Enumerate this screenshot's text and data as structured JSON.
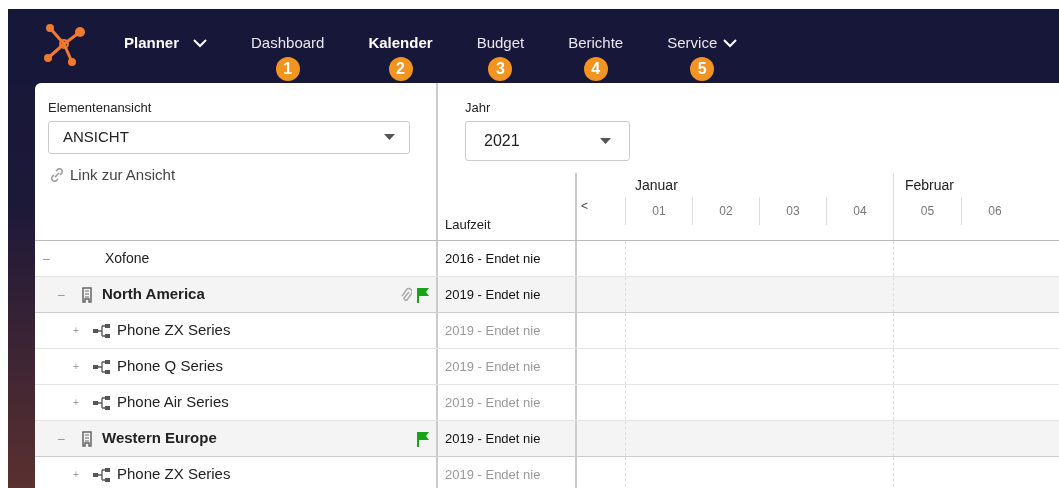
{
  "nav": {
    "app_menu": {
      "label": "Planner"
    },
    "items": [
      {
        "label": "Dashboard",
        "badge": "1",
        "selected": false,
        "has_menu": false
      },
      {
        "label": "Kalender",
        "badge": "2",
        "selected": true,
        "has_menu": false
      },
      {
        "label": "Budget",
        "badge": "3",
        "selected": false,
        "has_menu": false
      },
      {
        "label": "Berichte",
        "badge": "4",
        "selected": false,
        "has_menu": false
      },
      {
        "label": "Service",
        "badge": "5",
        "selected": false,
        "has_menu": true
      }
    ]
  },
  "view": {
    "label": "Elementenansicht",
    "value": "ANSICHT",
    "link": "Link zur Ansicht"
  },
  "year": {
    "label": "Jahr",
    "value": "2021"
  },
  "table": {
    "laufzeit_header": "Laufzeit",
    "prev": "<",
    "months": [
      {
        "label": "Januar",
        "weeks": [
          "01",
          "02",
          "03",
          "04"
        ]
      },
      {
        "label": "Februar",
        "weeks": [
          "05",
          "06"
        ]
      }
    ],
    "rows": [
      {
        "kind": "root",
        "label": "Xofone",
        "laufzeit": "2016 - Endet nie",
        "toggle": "−",
        "expanded": true,
        "attachment": false,
        "flag": false,
        "children": [
          {
            "kind": "region",
            "label": "North America",
            "laufzeit": "2019 - Endet nie",
            "toggle": "−",
            "expanded": true,
            "attachment": true,
            "flag": true,
            "children": [
              {
                "kind": "series",
                "label": "Phone ZX Series",
                "laufzeit": "2019 - Endet nie",
                "toggle": "+",
                "expanded": false,
                "attachment": false,
                "flag": false
              },
              {
                "kind": "series",
                "label": "Phone Q Series",
                "laufzeit": "2019 - Endet nie",
                "toggle": "+",
                "expanded": false,
                "attachment": false,
                "flag": false
              },
              {
                "kind": "series",
                "label": "Phone Air Series",
                "laufzeit": "2019 - Endet nie",
                "toggle": "+",
                "expanded": false,
                "attachment": false,
                "flag": false
              }
            ]
          },
          {
            "kind": "region",
            "label": "Western Europe",
            "laufzeit": "2019 - Endet nie",
            "toggle": "−",
            "expanded": true,
            "attachment": false,
            "flag": true,
            "children": [
              {
                "kind": "series",
                "label": "Phone ZX Series",
                "laufzeit": "2019 - Endet nie",
                "toggle": "+",
                "expanded": false,
                "attachment": false,
                "flag": false
              }
            ]
          }
        ]
      }
    ]
  }
}
